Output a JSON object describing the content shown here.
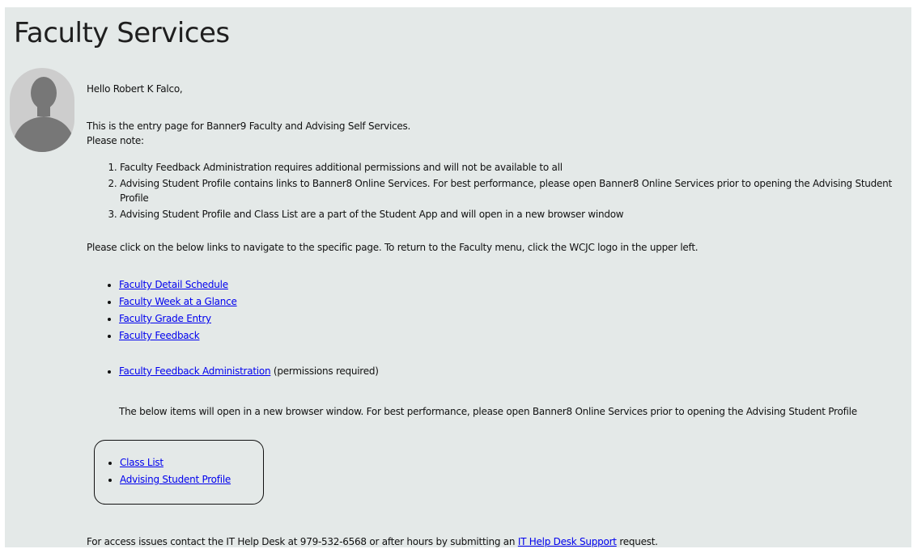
{
  "page": {
    "title": "Faculty Services"
  },
  "greeting": "Hello Robert K Falco,",
  "intro": "This is the entry page for Banner9 Faculty and Advising Self Services.",
  "please_note": "Please note:",
  "notes": [
    "Faculty Feedback Administration requires additional permissions and will not be available to all",
    "Advising Student Profile contains links to Banner8 Online Services. For best performance, please open Banner8 Online Services prior to opening the Advising Student Profile",
    "Advising Student Profile and Class List are a part of the Student App and will open in a new browser window"
  ],
  "nav_instructions": "Please click on the below links to navigate to the specific page. To return to the Faculty menu, click the WCJC logo in the upper left.",
  "links": [
    "Faculty Detail Schedule",
    "Faculty Week at a Glance",
    "Faculty Grade Entry",
    "Faculty Feedback"
  ],
  "admin_link": {
    "label": "Faculty Feedback Administration",
    "suffix": " (permissions required)"
  },
  "new_window_note": "The below items will open in a new browser window. For best performance, please open Banner8 Online Services prior to opening the Advising Student Profile",
  "student_app_links": [
    "Class List",
    "Advising Student Profile"
  ],
  "footer": {
    "prefix": "For access issues contact the IT Help Desk at 979-532-6568 or after hours by submitting an ",
    "link_label": "IT Help Desk Support",
    "suffix": " request."
  },
  "icons": {
    "avatar": "user-silhouette-icon"
  },
  "colors": {
    "background": "#e4e9e8",
    "link": "#0000ee",
    "avatar_bg": "#cdcdcd",
    "avatar_figure": "#777777"
  }
}
